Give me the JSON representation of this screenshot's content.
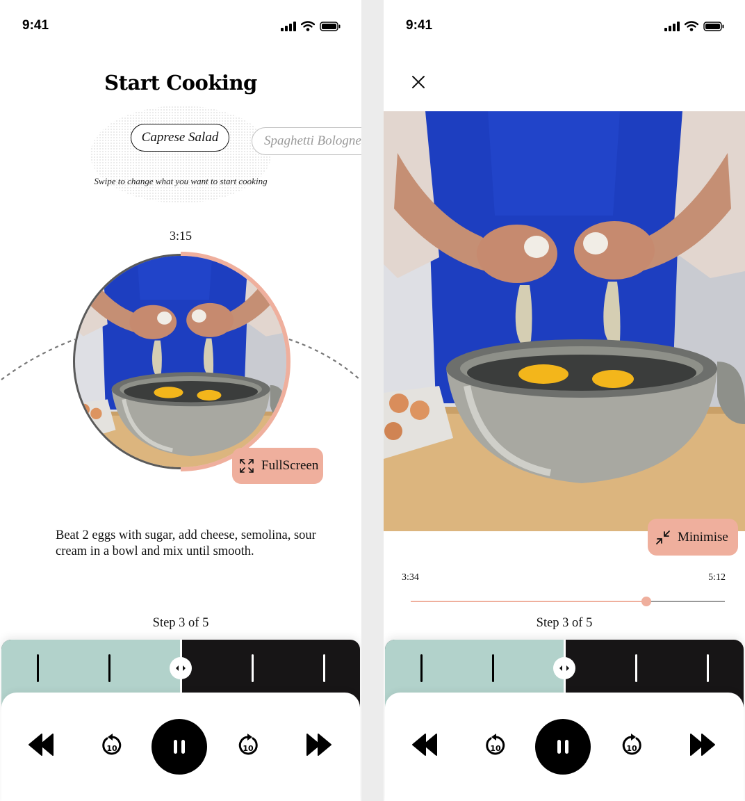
{
  "status_bar": {
    "time": "9:41"
  },
  "left_screen": {
    "title": "Start Cooking",
    "recipes": [
      "Caprese Salad",
      "Spaghetti Bolognese"
    ],
    "swipe_hint": "Swipe to change what you want to start cooking",
    "timer": "3:15",
    "timer_progress_fraction": 0.5,
    "fullscreen_label": "FullScreen",
    "instructions": "Beat 2 eggs with sugar, add cheese, semolina, sour cream in a bowl and mix until smooth."
  },
  "right_screen": {
    "minimise_label": "Minimise",
    "elapsed": "3:34",
    "total": "5:12",
    "progress_fraction": 0.75
  },
  "player": {
    "step_label": "Step 3 of 5",
    "current_step": 3,
    "total_steps": 5,
    "icons": [
      "rewind-icon",
      "replay-10-icon",
      "pause-icon",
      "forward-10-icon",
      "fast-forward-icon"
    ]
  },
  "colors": {
    "accent": "#efaf9d",
    "completed": "#b2d2cb",
    "remaining": "#171516"
  }
}
